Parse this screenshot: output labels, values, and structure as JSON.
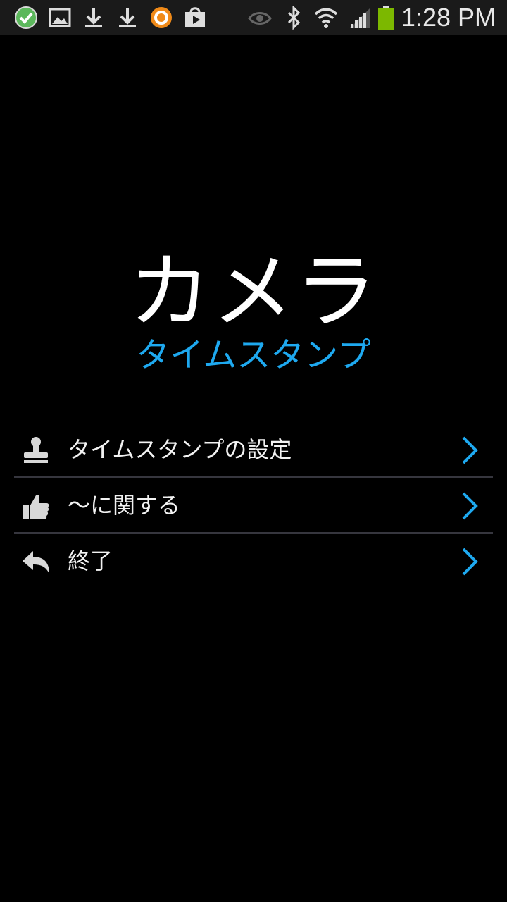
{
  "status_bar": {
    "time": "1:28 PM",
    "notification_icons": [
      "check-circle-icon",
      "image-icon",
      "download-icon",
      "download-icon",
      "avast-icon",
      "shopping-bag-icon"
    ],
    "system_icons": [
      "eye-icon",
      "bluetooth-icon",
      "wifi-icon",
      "signal-icon",
      "battery-icon"
    ],
    "battery_color": "#7cb800"
  },
  "app": {
    "title": "カメラ",
    "subtitle": "タイムスタンプ",
    "accent_color": "#1ea9f0"
  },
  "menu": {
    "items": [
      {
        "label": "タイムスタンプの設定",
        "icon": "stamp-icon"
      },
      {
        "label": "～に関する",
        "icon": "thumbs-up-icon"
      },
      {
        "label": "終了",
        "icon": "back-arrow-icon"
      }
    ]
  }
}
